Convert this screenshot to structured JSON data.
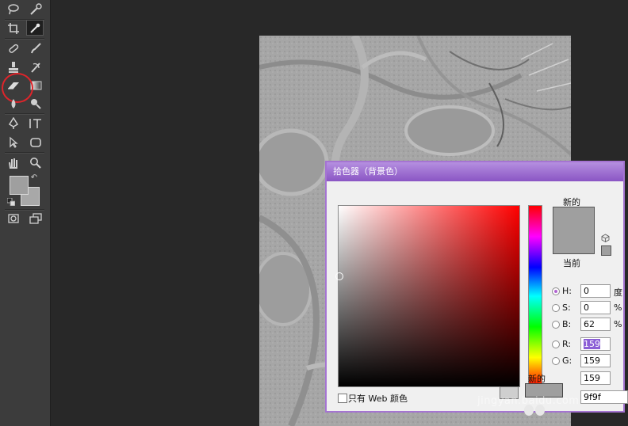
{
  "toolbar": {
    "tools": [
      {
        "name": "lasso-tool-icon"
      },
      {
        "name": "quick-selection-tool-icon"
      },
      {
        "name": "crop-tool-icon"
      },
      {
        "name": "eyedropper-tool-icon"
      },
      {
        "name": "spot-healing-brush-icon"
      },
      {
        "name": "brush-tool-icon"
      },
      {
        "name": "clone-stamp-tool-icon"
      },
      {
        "name": "history-brush-icon"
      },
      {
        "name": "eraser-tool-icon"
      },
      {
        "name": "gradient-tool-icon"
      },
      {
        "name": "blur-tool-icon"
      },
      {
        "name": "dodge-tool-icon"
      },
      {
        "name": "pen-tool-icon"
      },
      {
        "name": "type-tool-icon"
      },
      {
        "name": "path-selection-tool-icon"
      },
      {
        "name": "rectangle-tool-icon"
      },
      {
        "name": "hand-tool-icon"
      },
      {
        "name": "zoom-tool-icon"
      }
    ],
    "foreground_color": "#9f9f9f",
    "background_color": "#a8a8a8",
    "highlight_color": "#e0242a"
  },
  "dialog": {
    "title": "拾色器（背景色）",
    "new_label": "新的",
    "current_label": "当前",
    "new_small_label": "新的",
    "new_color": "#9f9f9f",
    "fields": {
      "H": {
        "label": "H:",
        "value": "0",
        "unit": "度",
        "checked": true
      },
      "S": {
        "label": "S:",
        "value": "0",
        "unit": "%"
      },
      "B": {
        "label": "B:",
        "value": "62",
        "unit": "%"
      },
      "R": {
        "label": "R:",
        "value": "159"
      },
      "G": {
        "label": "G:",
        "value": "159"
      },
      "B2": {
        "value": "159"
      }
    },
    "web_only_label": "只有 Web 颜色",
    "hex_value": "9f9f"
  },
  "watermark": "jingyan.baidu.com",
  "colors": {
    "accent": "#a574d2",
    "canvas": "#a4a4a4",
    "workspace": "#282828"
  }
}
